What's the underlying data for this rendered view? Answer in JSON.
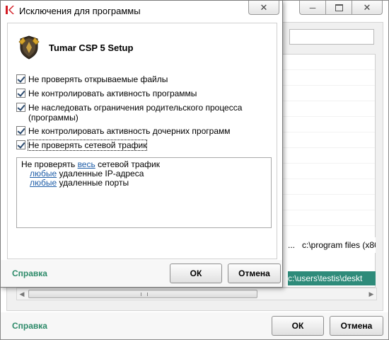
{
  "background_window": {
    "help_label": "Справка",
    "ok_label": "ОК",
    "cancel_label": "Отмена",
    "path_row_1": "c:\\program files (x86",
    "path_row_1_prefix": "...",
    "path_row_2": "c:\\users\\testis\\deskt"
  },
  "dialog": {
    "title": "Исключения для программы",
    "app_name": "Tumar CSP 5 Setup",
    "options": [
      {
        "label": "Не проверять открываемые файлы",
        "checked": true
      },
      {
        "label": "Не контролировать активность программы",
        "checked": true
      },
      {
        "label": "Не наследовать ограничения родительского процесса (программы)",
        "checked": true
      },
      {
        "label": "Не контролировать активность дочерних программ",
        "checked": true
      },
      {
        "label": "Не проверять сетевой трафик",
        "checked": true
      }
    ],
    "description": {
      "line1_prefix": "Не проверять ",
      "line1_link": "весь",
      "line1_suffix": " сетевой трафик",
      "line2_link": "любые",
      "line2_suffix": " удаленные IP-адреса",
      "line3_link": "любые",
      "line3_suffix": " удаленные порты"
    },
    "help_label": "Справка",
    "ok_label": "ОК",
    "cancel_label": "Отмена"
  },
  "colors": {
    "accent": "#2e8b6a",
    "link": "#1f5ea8",
    "selection": "#2e8b7a"
  }
}
